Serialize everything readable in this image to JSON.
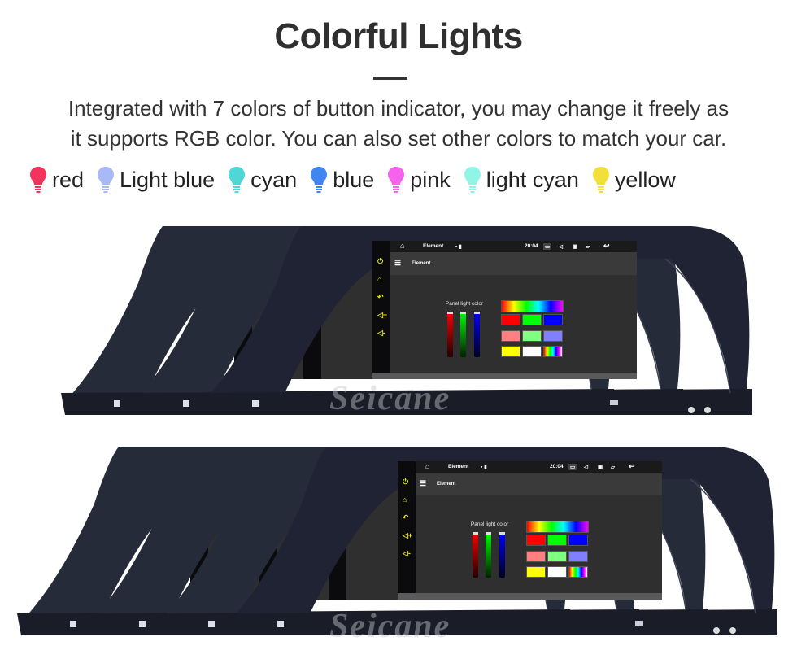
{
  "title": "Colorful Lights",
  "description": [
    "Integrated with 7 colors of button indicator, you may change it freely as",
    "it supports RGB color. You can also set other colors to match your car."
  ],
  "legend": [
    {
      "label": "red",
      "color": "#f2335e",
      "icon": "light-bulb-icon"
    },
    {
      "label": "Light blue",
      "color": "#a9b9f5",
      "icon": "light-bulb-icon"
    },
    {
      "label": "cyan",
      "color": "#4fd6d6",
      "icon": "light-bulb-icon"
    },
    {
      "label": "blue",
      "color": "#3f86f0",
      "icon": "light-bulb-icon"
    },
    {
      "label": "pink",
      "color": "#f562ee",
      "icon": "light-bulb-icon"
    },
    {
      "label": "light cyan",
      "color": "#8ff5e6",
      "icon": "light-bulb-icon"
    },
    {
      "label": "yellow",
      "color": "#f2df3a",
      "icon": "light-bulb-icon"
    }
  ],
  "screen": {
    "status_title": "Element",
    "time": "20:04",
    "header_title": "Element",
    "panel_label": "Panel light color",
    "palette": [
      "#ff0000",
      "#00ff00",
      "#0000ff",
      "#ff8080",
      "#80ff80",
      "#8080ff",
      "#ffff00",
      "#ffffff",
      "rainbow"
    ]
  },
  "watermark": "Seicane",
  "top_group_button_colors": [
    "#44dd44",
    "#7777ff",
    "#e5e51a"
  ],
  "bottom_group_button_colors": [
    "#ff2222",
    "#22dd22",
    "#2233ff",
    "#e5e51a"
  ]
}
